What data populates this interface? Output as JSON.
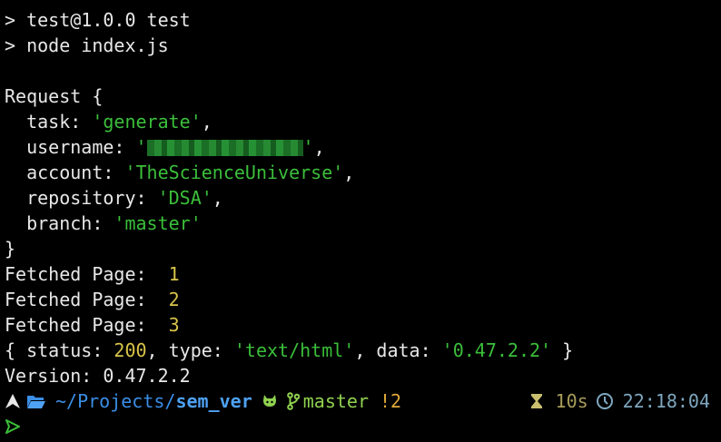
{
  "terminal": {
    "lines": {
      "l1": "> test@1.0.0 test",
      "l2": "> node index.js",
      "l3": "",
      "l4": "Request {",
      "task_key": "  task: ",
      "task_val": "'generate'",
      "task_end": ",",
      "user_key": "  username: ",
      "user_q1": "'",
      "user_q2": "'",
      "user_end": ",",
      "account_key": "  account: ",
      "account_val": "'TheScienceUniverse'",
      "account_end": ",",
      "repo_key": "  repository: ",
      "repo_val": "'DSA'",
      "repo_end": ",",
      "branch_key": "  branch: ",
      "branch_val": "'master'",
      "close": "}",
      "fetch_label": "Fetched Page:  ",
      "fetch_pages": [
        "1",
        "2",
        "3"
      ],
      "status_p1": "{ status: ",
      "status_val": "200",
      "status_p2": ", type: ",
      "type_val": "'text/html'",
      "status_p3": ", data: ",
      "data_val": "'0.47.2.2'",
      "status_p4": " }",
      "version": "Version: 0.47.2.2"
    }
  },
  "prompt": {
    "path_prefix": "~/Projects/",
    "path_dir": "sem_ver",
    "branch": "master",
    "changes": "!2",
    "duration": "10s",
    "time": "22:18:04",
    "icons": {
      "os": "arch-linux-icon",
      "folder": "folder-open-icon",
      "git": "github-icon",
      "branch": "git-branch-icon",
      "hourglass": "hourglass-icon",
      "clock": "clock-icon",
      "arrow": "prompt-arrow-icon"
    }
  },
  "colors": {
    "string": "#3bbf3b",
    "number": "#d8c44a",
    "path": "#3a8ee6",
    "git": "#8fd14f",
    "changes": "#e0a93a"
  }
}
